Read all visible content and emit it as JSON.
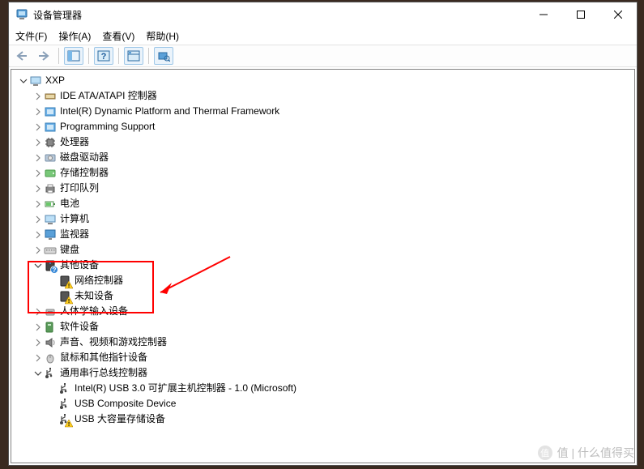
{
  "window": {
    "title": "设备管理器"
  },
  "menu": {
    "file": "文件(F)",
    "action": "操作(A)",
    "view": "查看(V)",
    "help": "帮助(H)"
  },
  "tree": {
    "root": "XXP",
    "items": [
      {
        "label": "IDE ATA/ATAPI 控制器",
        "icon": "ide"
      },
      {
        "label": "Intel(R) Dynamic Platform and Thermal Framework",
        "icon": "system"
      },
      {
        "label": "Programming Support",
        "icon": "system"
      },
      {
        "label": "处理器",
        "icon": "cpu"
      },
      {
        "label": "磁盘驱动器",
        "icon": "disk"
      },
      {
        "label": "存储控制器",
        "icon": "storage"
      },
      {
        "label": "打印队列",
        "icon": "printer"
      },
      {
        "label": "电池",
        "icon": "battery"
      },
      {
        "label": "计算机",
        "icon": "computer"
      },
      {
        "label": "监视器",
        "icon": "monitor"
      },
      {
        "label": "键盘",
        "icon": "keyboard"
      }
    ],
    "other_devices": {
      "label": "其他设备",
      "children": [
        {
          "label": "网络控制器"
        },
        {
          "label": "未知设备"
        }
      ]
    },
    "items2": [
      {
        "label": "人体学输入设备",
        "icon": "hid"
      },
      {
        "label": "软件设备",
        "icon": "software"
      },
      {
        "label": "声音、视频和游戏控制器",
        "icon": "audio"
      },
      {
        "label": "鼠标和其他指针设备",
        "icon": "mouse"
      }
    ],
    "usb": {
      "label": "通用串行总线控制器",
      "children": [
        {
          "label": "Intel(R) USB 3.0 可扩展主机控制器 - 1.0 (Microsoft)",
          "warn": false
        },
        {
          "label": "USB Composite Device",
          "warn": false
        },
        {
          "label": "USB 大容量存储设备",
          "warn": true
        }
      ]
    }
  },
  "watermark": "值 | 什么值得买"
}
